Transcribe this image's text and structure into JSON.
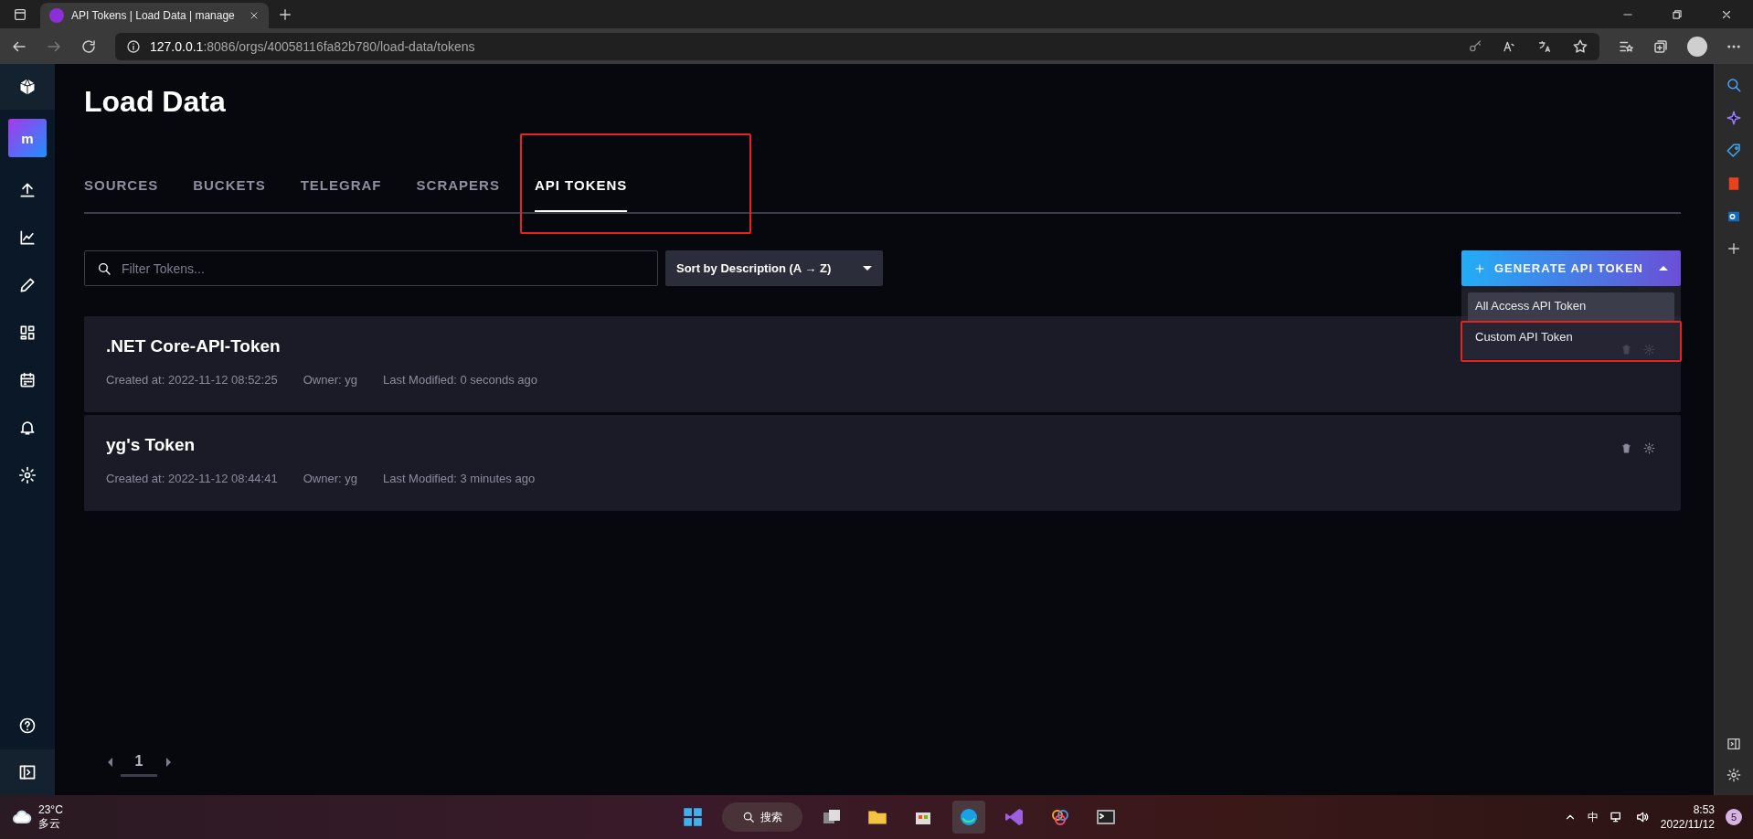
{
  "browser": {
    "tab_title": "API Tokens | Load Data | manage",
    "url_host": "127.0.0.1",
    "url_path": ":8086/orgs/40058116fa82b780/load-data/tokens"
  },
  "nav": {
    "org_initial": "m"
  },
  "page": {
    "title": "Load Data"
  },
  "tabs": [
    {
      "label": "SOURCES",
      "selected": false,
      "highlighted": false
    },
    {
      "label": "BUCKETS",
      "selected": false,
      "highlighted": false
    },
    {
      "label": "TELEGRAF",
      "selected": false,
      "highlighted": false
    },
    {
      "label": "SCRAPERS",
      "selected": false,
      "highlighted": false
    },
    {
      "label": "API TOKENS",
      "selected": true,
      "highlighted": true
    }
  ],
  "filter": {
    "placeholder": "Filter Tokens..."
  },
  "sort": {
    "value": "Sort by Description (A → Z)"
  },
  "generate_button": {
    "label": "GENERATE API TOKEN",
    "expanded": true
  },
  "generate_menu": [
    {
      "label": "All Access API Token",
      "selected": true,
      "highlighted": false
    },
    {
      "label": "Custom API Token",
      "selected": false,
      "highlighted": true
    }
  ],
  "tokens": [
    {
      "name": ".NET Core-API-Token",
      "created": "Created at: 2022-11-12 08:52:25",
      "owner": "Owner: yg",
      "modified": "Last Modified: 0 seconds ago"
    },
    {
      "name": "yg's Token",
      "created": "Created at: 2022-11-12 08:44:41",
      "owner": "Owner: yg",
      "modified": "Last Modified: 3 minutes ago"
    }
  ],
  "pagination": {
    "pages": [
      {
        "label": "1",
        "selected": true
      }
    ]
  },
  "taskbar": {
    "temperature": "23°C",
    "weather": "多云",
    "search": "搜索",
    "ime": "中",
    "time": "8:53",
    "date": "2022/11/12",
    "notifications": "5"
  }
}
